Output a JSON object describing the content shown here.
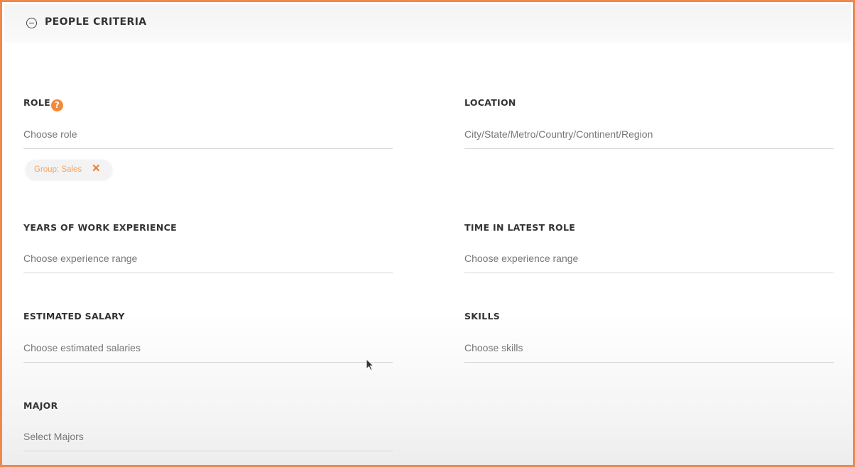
{
  "section": {
    "title": "PEOPLE CRITERIA",
    "collapse_icon": "minus-circle-icon"
  },
  "fields": {
    "role": {
      "label": "ROLE",
      "help_icon": "?",
      "placeholder": "Choose role",
      "tags": [
        {
          "label": "Group: Sales",
          "remove_icon": "✕"
        }
      ]
    },
    "location": {
      "label": "LOCATION",
      "placeholder": "City/State/Metro/Country/Continent/Region"
    },
    "years_experience": {
      "label": "YEARS OF WORK EXPERIENCE",
      "placeholder": "Choose experience range"
    },
    "time_in_role": {
      "label": "TIME IN LATEST ROLE",
      "placeholder": "Choose experience range"
    },
    "salary": {
      "label": "ESTIMATED SALARY",
      "placeholder": "Choose estimated salaries"
    },
    "skills": {
      "label": "SKILLS",
      "placeholder": "Choose skills"
    },
    "major": {
      "label": "MAJOR",
      "placeholder": "Select Majors"
    }
  },
  "colors": {
    "accent": "#f28a3b",
    "frame_border": "#f0884c",
    "tag_text": "#f5a35e"
  }
}
